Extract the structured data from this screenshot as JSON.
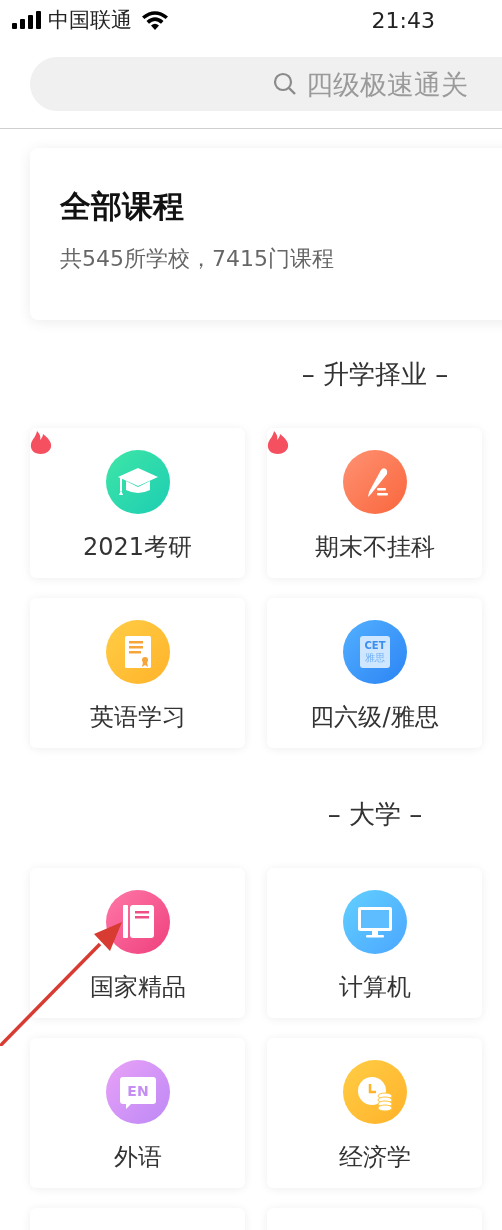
{
  "status_bar": {
    "carrier": "中国联通",
    "time": "21:43"
  },
  "search": {
    "placeholder": "四级极速通关"
  },
  "summary_card": {
    "title": "全部课程",
    "subtitle": "共545所学校，7415门课程"
  },
  "sections": [
    {
      "title": "– 升学择业 –",
      "items": [
        {
          "label": "2021考研",
          "hot": true,
          "kind": "cap"
        },
        {
          "label": "期末不挂科",
          "hot": true,
          "kind": "pencil"
        },
        {
          "label": "英语学习",
          "hot": false,
          "kind": "certificate"
        },
        {
          "label": "四六级/雅思",
          "hot": false,
          "kind": "cet"
        }
      ],
      "icon_texts": [
        {
          "kind": "cet",
          "text": [
            "CET",
            "雅思"
          ]
        }
      ]
    },
    {
      "title": "– 大学 –",
      "items": [
        {
          "label": "国家精品",
          "hot": false,
          "kind": "book"
        },
        {
          "label": "计算机",
          "hot": false,
          "kind": "monitor"
        },
        {
          "label": "外语",
          "hot": false,
          "kind": "en"
        },
        {
          "label": "经济学",
          "hot": false,
          "kind": "coins"
        }
      ],
      "icon_texts": [
        {
          "kind": "en",
          "text": [
            "EN"
          ]
        }
      ]
    }
  ]
}
